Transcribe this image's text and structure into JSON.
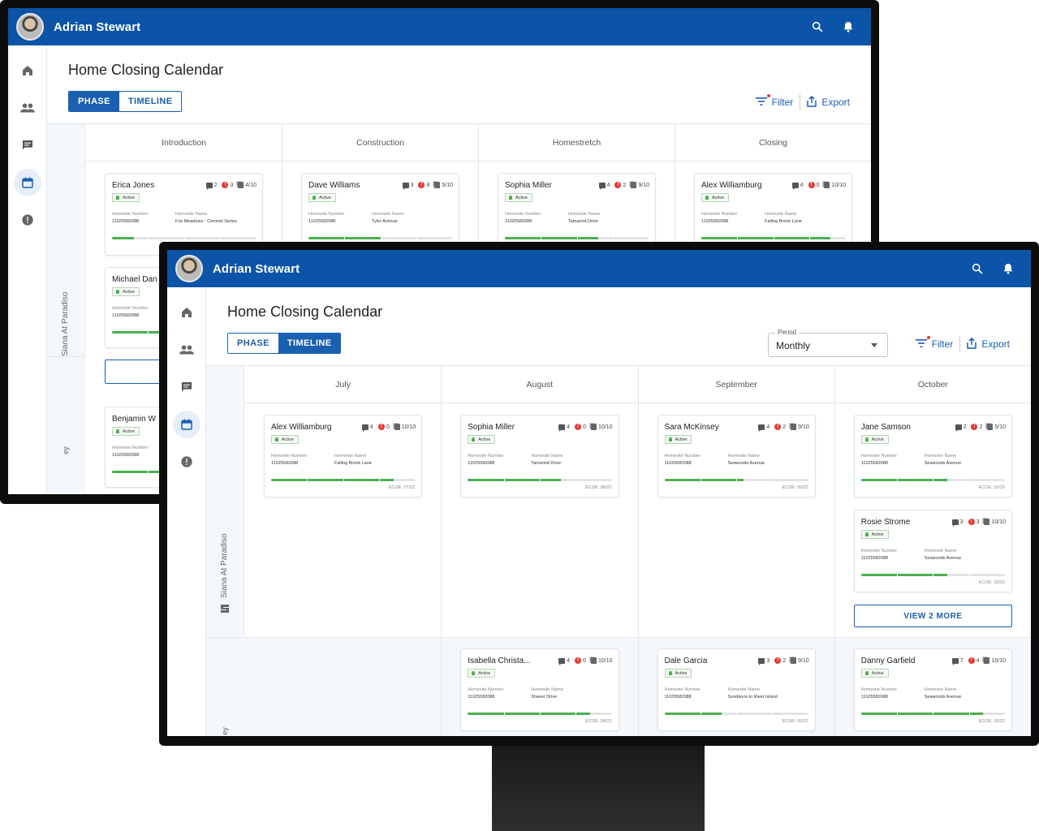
{
  "user": {
    "name": "Adrian Stewart"
  },
  "page": {
    "title": "Home Closing Calendar"
  },
  "view_toggle": {
    "phase": "PHASE",
    "timeline": "TIMELINE"
  },
  "toolbar": {
    "filter": "Filter",
    "export": "Export"
  },
  "period": {
    "label": "Period",
    "value": "Monthly"
  },
  "lane": {
    "name": "Siana At Paradiso",
    "second_name_fragment": "ey"
  },
  "back_window": {
    "active_view": "PHASE",
    "columns": [
      "Introduction",
      "Construction",
      "Homestretch",
      "Closing"
    ],
    "cards": [
      {
        "name": "Erica Jones",
        "chats": "2",
        "alerts": "3",
        "docs": "4/10",
        "status": "Active",
        "hs_num_label": "Homesite Number",
        "hs_num": "11025582088",
        "hs_name_label": "Homesite Name",
        "hs_name": "Fox Meadows - Coronet Series",
        "progress": 0.15
      },
      {
        "name": "Dave Williams",
        "chats": "3",
        "alerts": "8",
        "docs": "5/10",
        "status": "Active",
        "hs_num_label": "Homesite Number",
        "hs_num": "11025582088",
        "hs_name_label": "Homesite Name",
        "hs_name": "Tyler Avenue",
        "progress": 0.5
      },
      {
        "name": "Sophia Miller",
        "chats": "4",
        "alerts": "2",
        "docs": "9/10",
        "status": "Active",
        "hs_num_label": "Homesite Number",
        "hs_num": "11025582088",
        "hs_name_label": "Homesite Name",
        "hs_name": "Tamarind Drive",
        "progress": 0.65
      },
      {
        "name": "Alex Williamburg",
        "chats": "4",
        "alerts": "0",
        "docs": "10/10",
        "status": "Active",
        "hs_num_label": "Homesite Number",
        "hs_num": "11025582088",
        "hs_name_label": "Homesite Name",
        "hs_name": "Falling Brook Lane",
        "progress": 0.9
      },
      {
        "name": "Michael Dan",
        "status": "Active",
        "hs_num_label": "Homesite Number",
        "hs_num": "11025582088",
        "progress": 0.4
      },
      {
        "name": "Benjamin W",
        "status": "Active",
        "hs_num_label": "Homesite Number",
        "hs_num": "11025582088",
        "progress": 0.4
      }
    ]
  },
  "front_window": {
    "active_view": "TIMELINE",
    "columns": [
      "July",
      "August",
      "September",
      "October"
    ],
    "cards": [
      {
        "name": "Alex Williamburg",
        "chats": "4",
        "alerts": "0",
        "docs": "10/10",
        "status": "Active",
        "hs_num_label": "Homesite Number",
        "hs_num": "11025582088",
        "hs_name_label": "Homesite Name",
        "hs_name": "Falling Brook Lane",
        "ecoe": "ECOE: 07/22",
        "progress": 0.85
      },
      {
        "name": "Sophia Miller",
        "chats": "4",
        "alerts": "0",
        "docs": "10/10",
        "status": "Active",
        "hs_num_label": "Homesite Number",
        "hs_num": "11025582088",
        "hs_name_label": "Homesite Name",
        "hs_name": "Tamarind Drive",
        "ecoe": "ECOE: 08/22",
        "progress": 0.65
      },
      {
        "name": "Sara McKinsey",
        "chats": "4",
        "alerts": "2",
        "docs": "9/10",
        "status": "Active",
        "hs_num_label": "Homesite Number",
        "hs_num": "11025582088",
        "hs_name_label": "Homesite Name",
        "hs_name": "Seawoods Avenue",
        "ecoe": "ECOE: 09/22",
        "progress": 0.55
      },
      {
        "name": "Jane Samson",
        "chats": "2",
        "alerts": "2",
        "docs": "5/10",
        "status": "Active",
        "hs_num_label": "Homesite Number",
        "hs_num": "11025582088",
        "hs_name_label": "Homesite Name",
        "hs_name": "Seawoods Avenue",
        "ecoe": "ECOE: 10/22",
        "progress": 0.6
      },
      {
        "name": "Rosie Strome",
        "chats": "3",
        "alerts": "3",
        "docs": "10/10",
        "status": "Active",
        "hs_num_label": "Homesite Number",
        "hs_num": "11025582088",
        "hs_name_label": "Homesite Name",
        "hs_name": "Seawoods Avenue",
        "ecoe": "ECOE: 10/22",
        "progress": 0.6
      },
      {
        "name": "Isabella Christa...",
        "chats": "4",
        "alerts": "0",
        "docs": "10/10",
        "status": "Active",
        "hs_num_label": "Homesite Number",
        "hs_num": "11025582088",
        "hs_name_label": "Homesite Name",
        "hs_name": "Shaver Drive",
        "ecoe": "ECOE: 08/22",
        "progress": 0.85
      },
      {
        "name": "Dale Garcia",
        "chats": "3",
        "alerts": "2",
        "docs": "9/10",
        "status": "Active",
        "hs_num_label": "Homesite Number",
        "hs_num": "11025582088",
        "hs_name_label": "Homesite Name",
        "hs_name": "Sundance in River Island",
        "ecoe": "ECOE: 09/22",
        "progress": 0.4
      },
      {
        "name": "Danny Garfield",
        "chats": "7",
        "alerts": "4",
        "docs": "10/10",
        "status": "Active",
        "hs_num_label": "Homesite Number",
        "hs_num": "11025582088",
        "hs_name_label": "Homesite Name",
        "hs_name": "Seawoods Avenue",
        "ecoe": "ECOE: 10/22",
        "progress": 0.85
      }
    ],
    "view_more": "VIEW 2 MORE"
  },
  "colors": {
    "appbar": "#0b54a7",
    "accent": "#1a5fb0",
    "progress": "#4caf50",
    "alert": "#e53935"
  },
  "icons": [
    "home-icon",
    "people-icon",
    "chat-icon",
    "calendar-icon",
    "alert-icon",
    "search-icon",
    "bell-icon",
    "filter-icon",
    "export-icon"
  ]
}
